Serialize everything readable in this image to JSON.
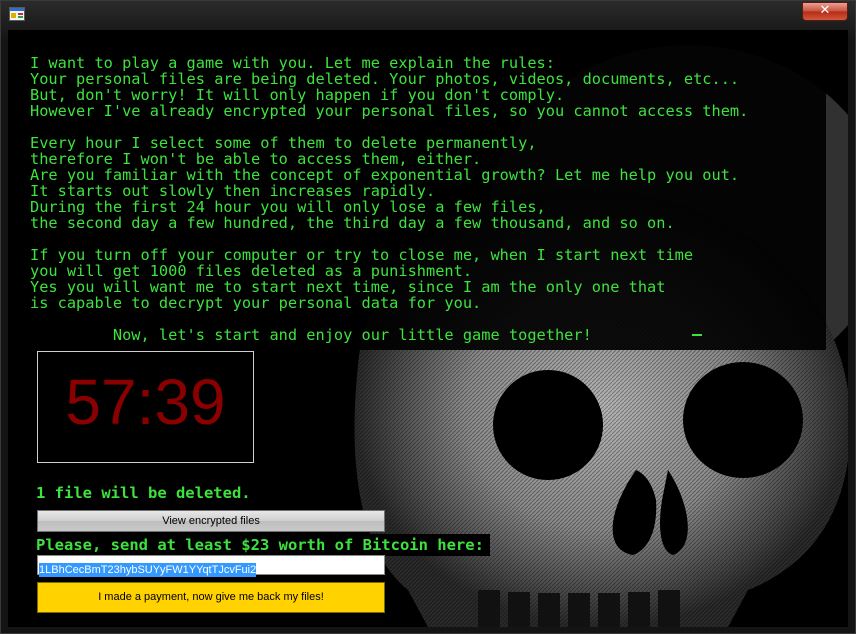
{
  "window": {
    "close_label": "✕"
  },
  "message": {
    "text": "I want to play a game with you. Let me explain the rules:\nYour personal files are being deleted. Your photos, videos, documents, etc...\nBut, don't worry! It will only happen if you don't comply.\nHowever I've already encrypted your personal files, so you cannot access them.\n\nEvery hour I select some of them to delete permanently,\ntherefore I won't be able to access them, either.\nAre you familiar with the concept of exponential growth? Let me help you out.\nIt starts out slowly then increases rapidly.\nDuring the first 24 hour you will only lose a few files,\nthe second day a few hundred, the third day a few thousand, and so on.\n\nIf you turn off your computer or try to close me, when I start next time\nyou will get 1000 files deleted as a punishment.\nYes you will want me to start next time, since I am the only one that\nis capable to decrypt your personal data for you.\n\n         Now, let's start and enjoy our little game together!"
  },
  "timer": {
    "value": "57:39"
  },
  "deletion_notice": "1 file will be deleted.",
  "buttons": {
    "view_encrypted": "View encrypted files",
    "payment": "I made a payment, now give me back my files!"
  },
  "payment": {
    "prompt": "Please, send at least $23 worth of Bitcoin here:",
    "address": "1LBhCecBmT23hybSUYyFW1YYqtTJcvFui2"
  },
  "colors": {
    "text_green": "#3ee23e",
    "timer_red": "#8a0000",
    "pay_button": "#ffd200",
    "selection": "#3399ff"
  },
  "icons": {
    "app": "app-window-icon",
    "close": "close-icon",
    "background": "skull-artwork"
  }
}
